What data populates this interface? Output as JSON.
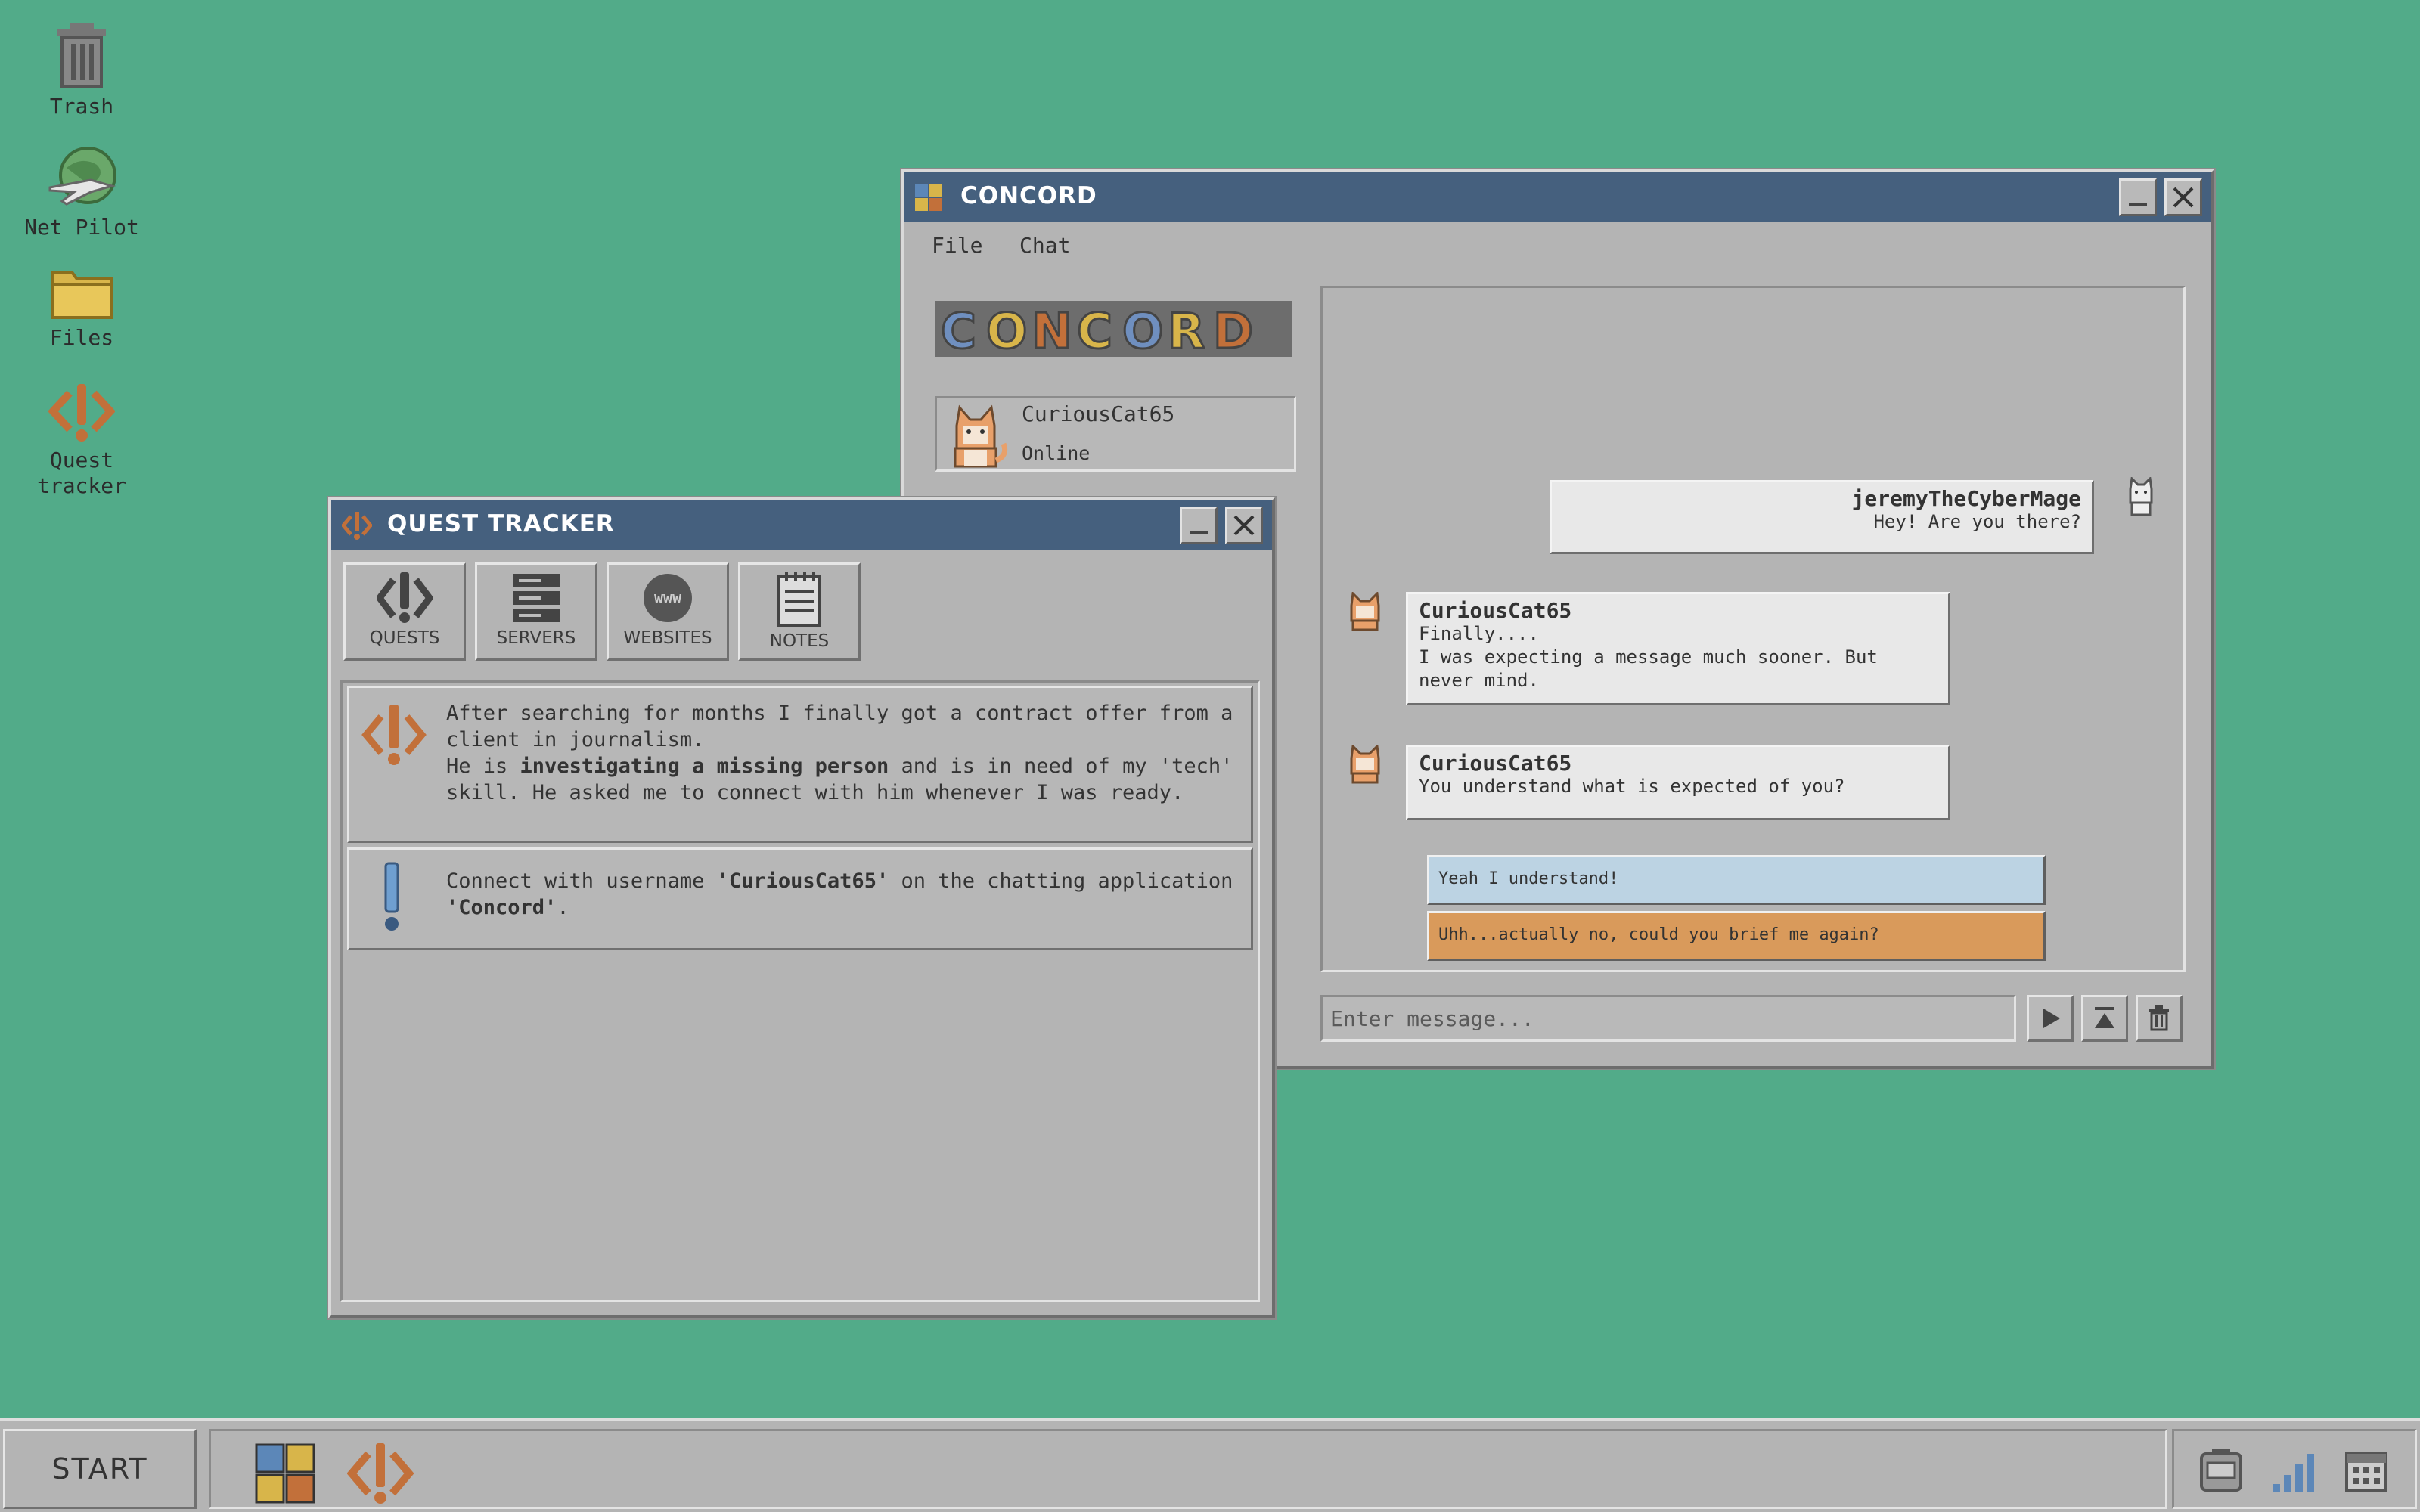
{
  "desktop": {
    "icons": [
      {
        "label": "Trash",
        "icon": "trash-icon"
      },
      {
        "label": "Net Pilot",
        "icon": "globe-plane-icon"
      },
      {
        "label": "Files",
        "icon": "folder-icon"
      },
      {
        "label": "Quest\ntracker",
        "icon": "quest-icon"
      }
    ]
  },
  "concord": {
    "title": "CONCORD",
    "menu": {
      "file": "File",
      "chat": "Chat"
    },
    "logo_text": "CONCORD",
    "user": {
      "name": "CuriousCat65",
      "status": "Online"
    },
    "messages": [
      {
        "author": "jeremyTheCyberMage",
        "text": "Hey! Are you there?"
      },
      {
        "author": "CuriousCat65",
        "text": "Finally....\nI was expecting a message much sooner. But\nnever mind."
      },
      {
        "author": "CuriousCat65",
        "text": "You understand what is expected of you?"
      }
    ],
    "replies": [
      {
        "text": "Yeah I understand!",
        "color": "#bcd3e3"
      },
      {
        "text": "Uhh...actually no, could you brief me again?",
        "color": "#d99a5b"
      }
    ],
    "input_placeholder": "Enter message..."
  },
  "quest_tracker": {
    "title": "QUEST TRACKER",
    "tabs": [
      {
        "label": "QUESTS",
        "icon": "quest-icon"
      },
      {
        "label": "SERVERS",
        "icon": "server-icon"
      },
      {
        "label": "WEBSITES",
        "icon": "www-icon"
      },
      {
        "label": "NOTES",
        "icon": "notepad-icon"
      }
    ],
    "items": [
      {
        "p1": "After searching for months I finally got a contract offer from a client in journalism.",
        "p2a": "He is ",
        "p2b": "investigating a missing person",
        "p2c": " and is in need of my 'tech' skill. He asked me to connect with him whenever I was ready."
      },
      {
        "a": "Connect with username ",
        "b": "'CuriousCat65'",
        "c": " on the chatting application ",
        "d": "'Concord'",
        "e": "."
      }
    ]
  },
  "taskbar": {
    "start": "START"
  },
  "colors": {
    "desktop": "#52ab89",
    "titlebar": "#45607e",
    "window": "#b4b4b4"
  }
}
